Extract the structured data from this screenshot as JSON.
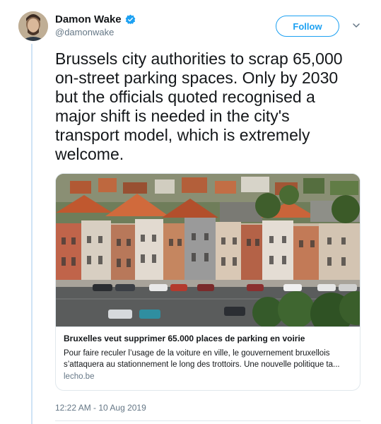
{
  "author": {
    "display_name": "Damon Wake",
    "handle": "@damonwake",
    "verified": true
  },
  "follow_button": {
    "label": "Follow"
  },
  "tweet": {
    "lines": [
      "Brussels city authorities to scrap 65,000",
      "on-street parking spaces. Only by 2030",
      "but the officials quoted recognised a",
      "major shift is needed in the city's",
      "transport model, which is extremely",
      "welcome."
    ],
    "timestamp": "12:22 AM - 10 Aug 2019"
  },
  "card": {
    "title": "Bruxelles veut supprimer 65.000 places de parking en voirie",
    "description_lines": [
      "Pour faire reculer l’usage de la voiture en ville, le gouvernement bruxellois",
      "s’attaquera au stationnement le long des trottoirs. Une nouvelle politique ta..."
    ],
    "domain": "lecho.be"
  },
  "colors": {
    "accent": "#1da1f2",
    "text": "#14171a",
    "secondary_text": "#657786",
    "border": "#e1e8ed"
  },
  "icons": {
    "verified": "verified-badge-icon",
    "more": "chevron-down-icon"
  }
}
